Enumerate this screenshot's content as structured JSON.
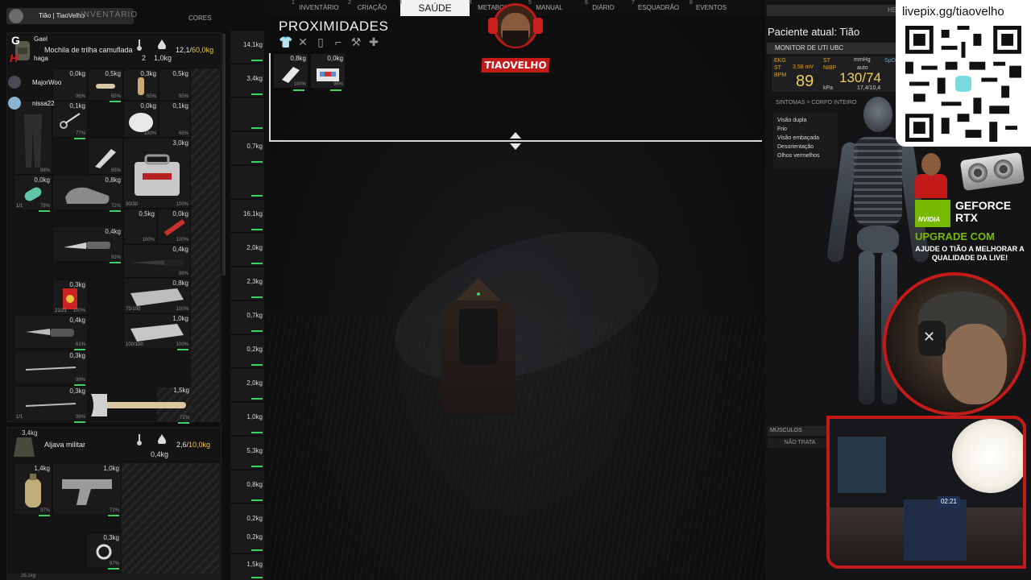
{
  "nav": {
    "tabs": [
      {
        "num": "1",
        "label": "INVENTÁRIO"
      },
      {
        "num": "2",
        "label": "CRIAÇÃO"
      },
      {
        "num": "3",
        "label": "SAÚDE"
      },
      {
        "num": "4",
        "label": "METABOL"
      },
      {
        "num": "5",
        "label": "MANUAL"
      },
      {
        "num": "6",
        "label": "DIÁRIO"
      },
      {
        "num": "7",
        "label": "ESQUADRÃO"
      },
      {
        "num": "8",
        "label": "EVENTOS"
      }
    ],
    "active": "SAÚDE",
    "colors_label": "CORES"
  },
  "logo": {
    "text": "TIAOVELHO"
  },
  "inventory": {
    "header_name": "Tião | TiaoVelho",
    "header_ghost": "INVENTÁRIO",
    "viewers": [
      "Gael",
      "haga",
      "MajorWoo",
      "nissa22"
    ],
    "backpack": {
      "name": "Mochila de trilha camuflada",
      "temp": "2",
      "weight": "1,0kg",
      "capacity_used": "12,1",
      "capacity_max": "60,0kg"
    },
    "vest": {
      "name": "Aljava militar",
      "weight_self": "3,4kg",
      "weight": "0,4kg",
      "capacity_used": "2,6",
      "capacity_max": "10,0kg"
    },
    "items": [
      {
        "w": "0,0kg",
        "q": "",
        "dur": "96%"
      },
      {
        "w": "0,5kg",
        "q": "",
        "dur": "65%"
      },
      {
        "w": "0,3kg",
        "q": "",
        "dur": "65%"
      },
      {
        "w": "0,5kg",
        "q": "",
        "dur": "65%"
      },
      {
        "w": "0,1kg",
        "q": "",
        "dur": "77%"
      },
      {
        "w": "0,0kg",
        "q": "",
        "dur": "100%"
      },
      {
        "w": "0,1kg",
        "q": "",
        "dur": "65%"
      },
      {
        "w": "3,0kg",
        "q": "",
        "dur": "100%"
      },
      {
        "w": "",
        "q": "",
        "dur": "98%"
      },
      {
        "w": "",
        "q": "",
        "dur": "95%"
      },
      {
        "w": "0,0kg",
        "q": "1/1",
        "dur": "78%"
      },
      {
        "w": "0,8kg",
        "q": "",
        "dur": "72%"
      },
      {
        "w": "",
        "q": "30/30",
        "dur": "100%"
      },
      {
        "w": "0,5kg",
        "q": "",
        "dur": "100%"
      },
      {
        "w": "0,0kg",
        "q": "",
        "dur": "100%"
      },
      {
        "w": "0,4kg",
        "q": "",
        "dur": "93%"
      },
      {
        "w": "0,4kg",
        "q": "",
        "dur": "89%"
      },
      {
        "w": "0,3kg",
        "q": "21/21",
        "dur": "100%"
      },
      {
        "w": "0,8kg",
        "q": "75/100",
        "dur": "100%"
      },
      {
        "w": "0,4kg",
        "q": "",
        "dur": "61%"
      },
      {
        "w": "1,0kg",
        "q": "100/100",
        "dur": "100%"
      },
      {
        "w": "0,3kg",
        "q": "",
        "dur": "99%"
      },
      {
        "w": "0,3kg",
        "q": "1/1",
        "dur": "99%"
      },
      {
        "w": "1,5kg",
        "q": "",
        "dur": "72%"
      }
    ],
    "vest_items": [
      {
        "w": "1,4kg",
        "q": "",
        "dur": "97%"
      },
      {
        "w": "1,0kg",
        "q": "",
        "dur": "72%"
      },
      {
        "w": "0,3kg",
        "q": "",
        "dur": "97%"
      }
    ],
    "equipment": [
      "14,1kg",
      "3,4kg",
      "",
      "0,7kg",
      "",
      "16,1kg",
      "2,0kg",
      "2,3kg",
      "0,7kg",
      "0,2kg",
      "2,0kg",
      "1,0kg",
      "5,3kg",
      "0,8kg",
      "0,2kg",
      "0,2kg",
      "1,5kg"
    ],
    "bottom_weight": "26,1kg"
  },
  "proximity": {
    "title": "PROXIMIDADES",
    "items": [
      {
        "w": "0,8kg",
        "dur": "100%"
      },
      {
        "w": "0,0kg",
        "dur": "96%"
      }
    ]
  },
  "health": {
    "top_label": "HE",
    "patient": "Paciente atual: Tião",
    "monitor_title": "MONITOR DE UTI UBC",
    "ekg_label": "EKG",
    "ekg_value": "3,58 mV",
    "st_label": "ST",
    "bpm_label": "BPM",
    "bpm_value": "89",
    "nibp_label": "NIBP",
    "nibp_units": "mmHg",
    "nibp_mode": "auto",
    "nibp_value": "130/74",
    "kpa": "17,4/10,4",
    "kpa_label": "kPa",
    "spo2_label": "SpO2",
    "symptoms_title": "SINTOMAS > CORPO INTEIRO",
    "symptoms": [
      "Visão dupla",
      "Frio",
      "Visão embaçada",
      "Desorientação",
      "Olhos vermelhos"
    ],
    "muscles_label": "MÚSCULOS",
    "untreated_label": "NÃO TRATA"
  },
  "overlay": {
    "url": "livepix.gg/tiaovelho",
    "geforce": "GEFORCE RTX",
    "nvidia": "NVIDIA",
    "upgrade": "UPGRADE COM",
    "help": "AJUDE O TIÃO A MELHORAR A QUALIDADE DA LIVE!",
    "clock": "02:21"
  },
  "colors": {
    "accent_red": "#c41a1a",
    "durability_green": "#3fcf63",
    "capacity_yellow": "#e9c440",
    "nvidia_green": "#76b900"
  }
}
